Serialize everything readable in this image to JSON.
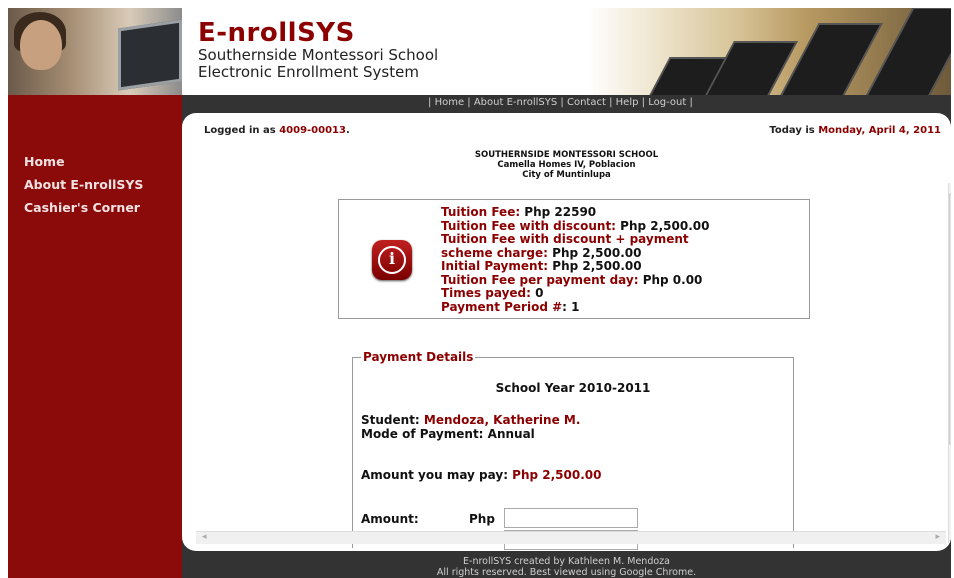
{
  "banner": {
    "brand": "E-nrollSYS",
    "subtitle1": "Southernside Montessori School",
    "subtitle2": "Electronic Enrollment System"
  },
  "menu": {
    "sep": "|",
    "items": [
      "Home",
      "About E-nrollSYS",
      "Contact",
      "Help",
      "Log-out"
    ]
  },
  "sidebar": {
    "items": [
      "Home",
      "About E-nrollSYS",
      "Cashier's Corner"
    ]
  },
  "status": {
    "logged_prefix": "Logged in as ",
    "user_id": "4009-00013",
    "logged_suffix": ".",
    "today_prefix": "Today is ",
    "today_date": "Monday, April 4, 2011"
  },
  "school": {
    "name": "SOUTHERNSIDE MONTESSORI SCHOOL",
    "address1": "Camella Homes IV, Poblacion",
    "address2": "City of Muntinlupa"
  },
  "info": {
    "tuition_label": "Tuition Fee:",
    "tuition_value": " Php 22590",
    "discount_label": "Tuition Fee with discount:",
    "discount_value": " Php 2,500.00",
    "scheme_label_1": "Tuition Fee with discount + payment",
    "scheme_label_2": "scheme charge:",
    "scheme_value": " Php 2,500.00",
    "initial_label": "Initial Payment:",
    "initial_value": " Php 2,500.00",
    "perday_label": "Tuition Fee per payment day:",
    "perday_value": " Php 0.00",
    "times_label": "Times payed:",
    "times_value": " 0",
    "period_label": "Payment Period #",
    "period_value": ": 1"
  },
  "payment": {
    "legend": "Payment Details",
    "school_year": "School Year 2010-2011",
    "student_label": "Student: ",
    "student_name": "Mendoza, Katherine M.",
    "mode_label": "Mode of Payment: ",
    "mode_value": "Annual",
    "may_pay_label": "Amount you may pay: ",
    "may_pay_value": "Php 2,500.00",
    "amount_label": "Amount:",
    "currency": "Php",
    "amount_value": ""
  },
  "footer": {
    "line1": "E-nrollSYS created by Kathleen M. Mendoza",
    "line2": "All rights reserved. Best viewed using Google Chrome."
  },
  "colors": {
    "accent": "#8b0000",
    "sidebar": "#8b0a0a",
    "dark": "#333333"
  }
}
